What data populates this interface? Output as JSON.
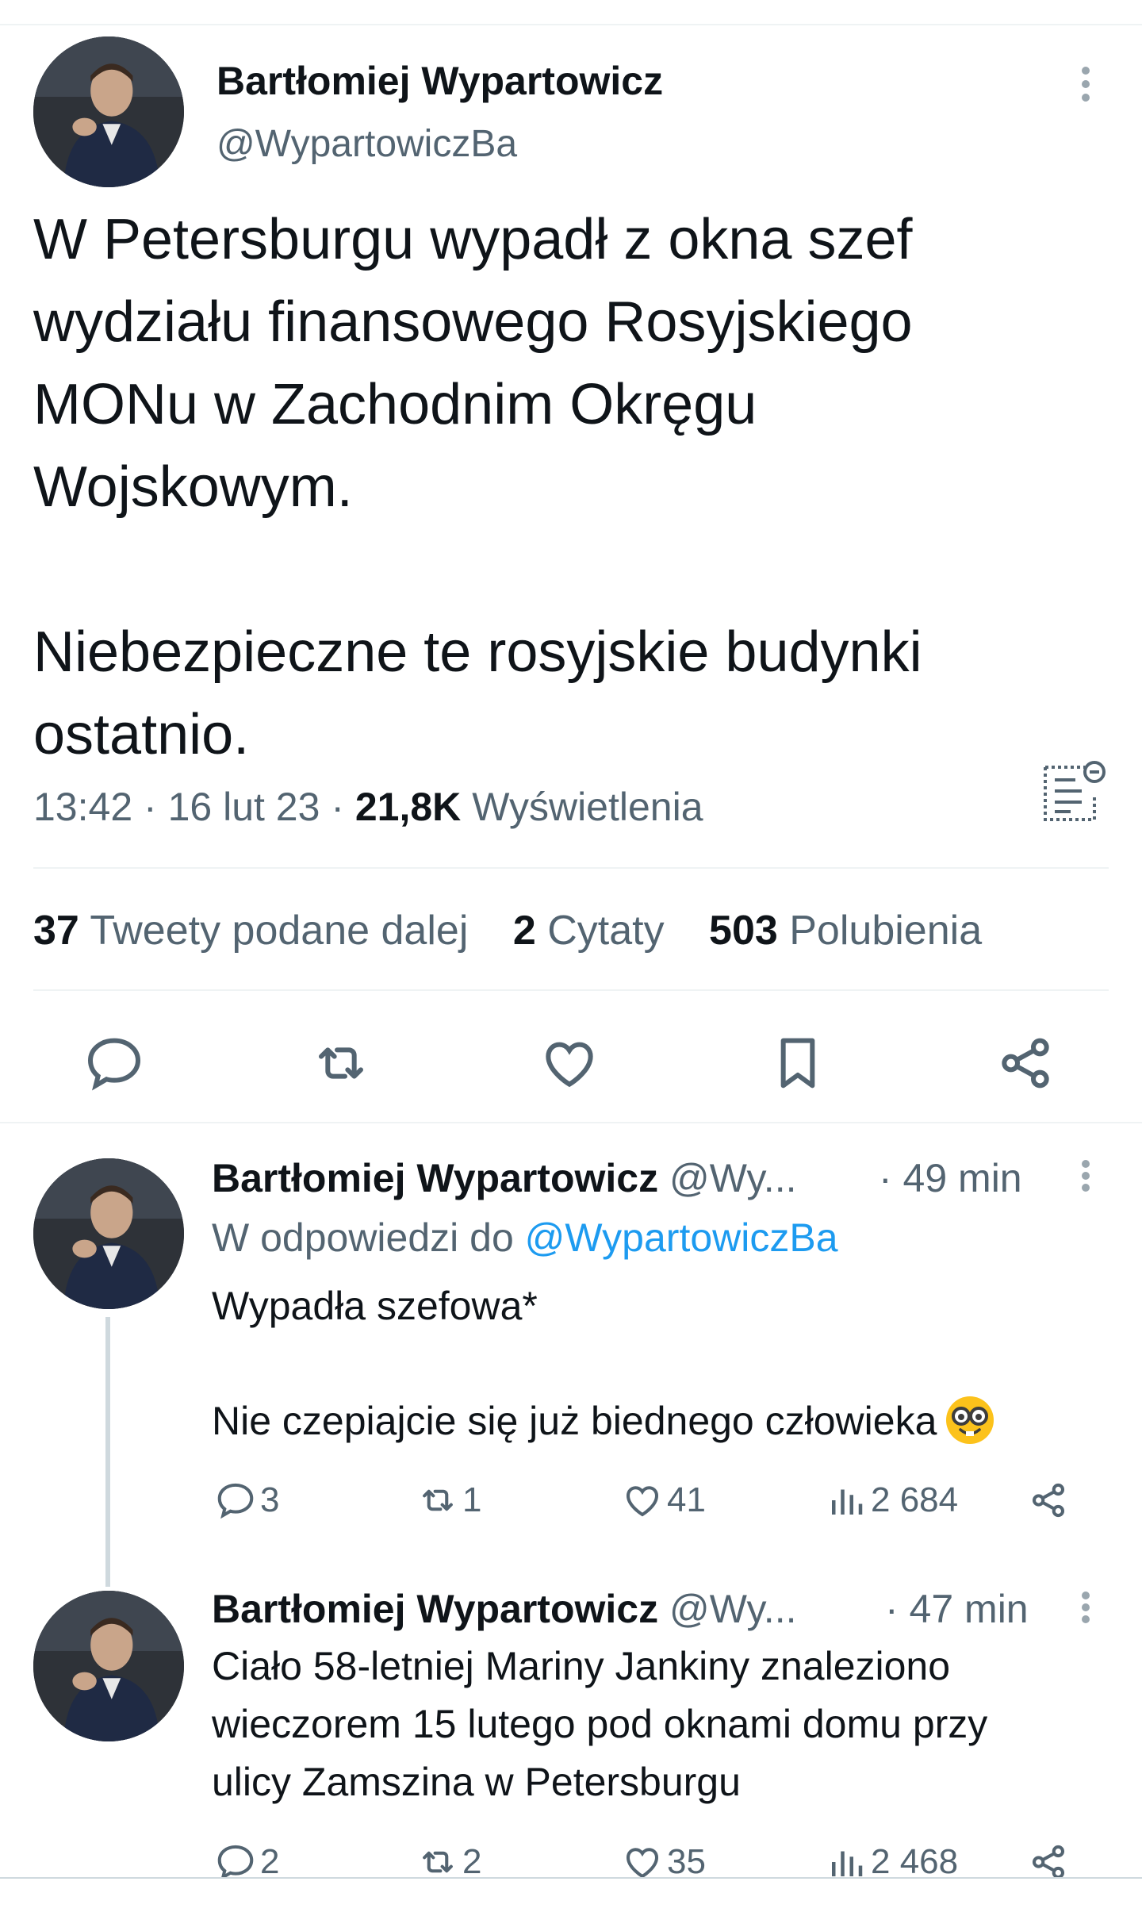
{
  "main_tweet": {
    "author_name": "Bartłomiej Wypartowicz",
    "author_handle": "@WypartowiczBa",
    "text_lines": [
      "W Petersburgu wypadł z okna szef",
      "wydziału finansowego Rosyjskiego",
      "MONu w Zachodnim Okręgu",
      "Wojskowym.",
      "Niebezpieczne te rosyjskie budynki",
      "ostatnio."
    ],
    "time": "13:42",
    "date": "16 lut 23",
    "views_count": "21,8K",
    "views_label": "Wyświetlenia",
    "stats": {
      "retweets_count": "37",
      "retweets_label": "Tweety podane dalej",
      "quotes_count": "2",
      "quotes_label": "Cytaty",
      "likes_count": "503",
      "likes_label": "Polubienia"
    }
  },
  "replies": [
    {
      "author_name": "Bartłomiej Wypartowicz",
      "author_handle": "@Wy...",
      "time": "· 49 min",
      "reply_to_label": "W odpowiedzi do",
      "reply_to_handle": "@WypartowiczBa",
      "text_lines": [
        "Wypadła szefowa*",
        "Nie czepiajcie się już biednego  człowieka"
      ],
      "comments": "3",
      "retweets": "1",
      "likes": "41",
      "views": "2 684"
    },
    {
      "author_name": "Bartłomiej Wypartowicz",
      "author_handle": "@Wy...",
      "time": "· 47 min",
      "text_lines": [
        "Ciało 58-letniej Mariny Jankiny znaleziono",
        "wieczorem 15 lutego pod oknami domu przy",
        "ulicy Zamszina w Petersburgu"
      ],
      "comments": "2",
      "retweets": "2",
      "likes": "35",
      "views": "2 468"
    }
  ],
  "icons": {
    "more": "more-vertical-icon",
    "translate": "translate-icon",
    "reply": "reply-icon",
    "retweet": "retweet-icon",
    "like": "heart-icon",
    "bookmark": "bookmark-icon",
    "share": "share-icon",
    "views": "views-bar-icon",
    "emoji": "nerd-face-emoji"
  },
  "colors": {
    "text": "#0f1419",
    "muted": "#536471",
    "link": "#1d9bf0",
    "divider": "#eff3f4"
  }
}
